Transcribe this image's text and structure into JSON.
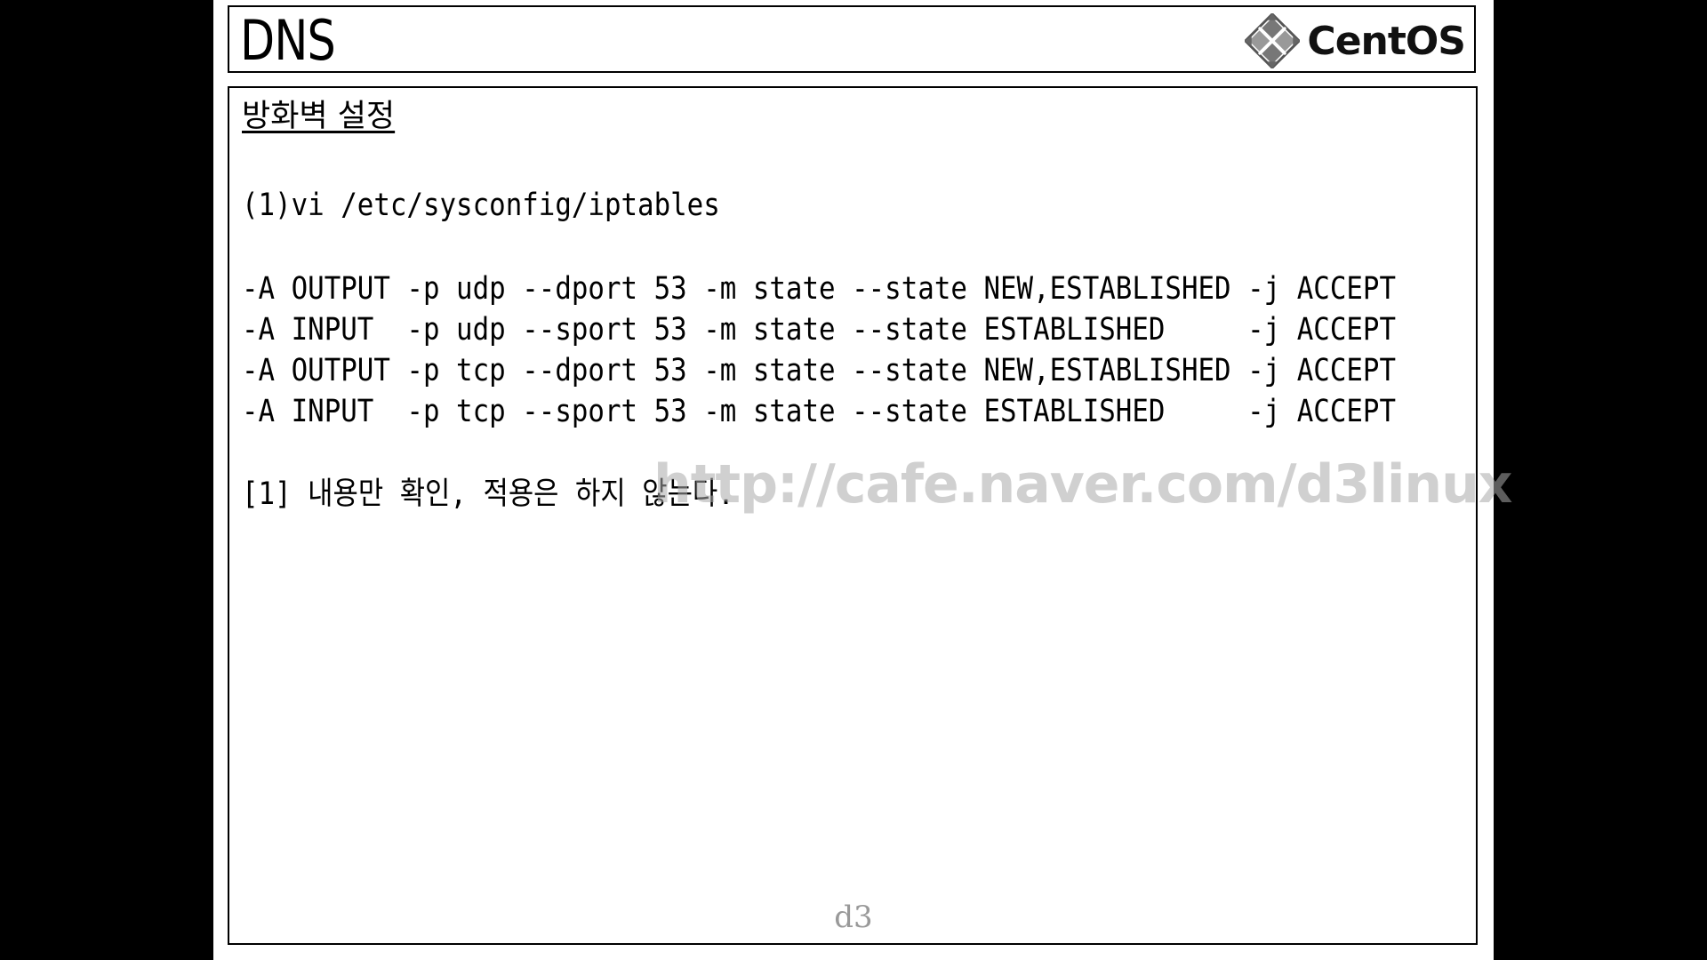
{
  "title": "DNS",
  "logo": {
    "text": "CentOS",
    "icon": "centos-logo-icon"
  },
  "heading": "방화벽 설정",
  "step": "(1)vi /etc/sysconfig/iptables",
  "rules": [
    "-A OUTPUT -p udp --dport 53 -m state --state NEW,ESTABLISHED -j ACCEPT",
    "-A INPUT  -p udp --sport 53 -m state --state ESTABLISHED     -j ACCEPT",
    "-A OUTPUT -p tcp --dport 53 -m state --state NEW,ESTABLISHED -j ACCEPT",
    "-A INPUT  -p tcp --sport 53 -m state --state ESTABLISHED     -j ACCEPT"
  ],
  "note": "[1] 내용만 확인, 적용은 하지 않는다.",
  "watermark": "http://cafe.naver.com/d3linux",
  "footer": "d3"
}
